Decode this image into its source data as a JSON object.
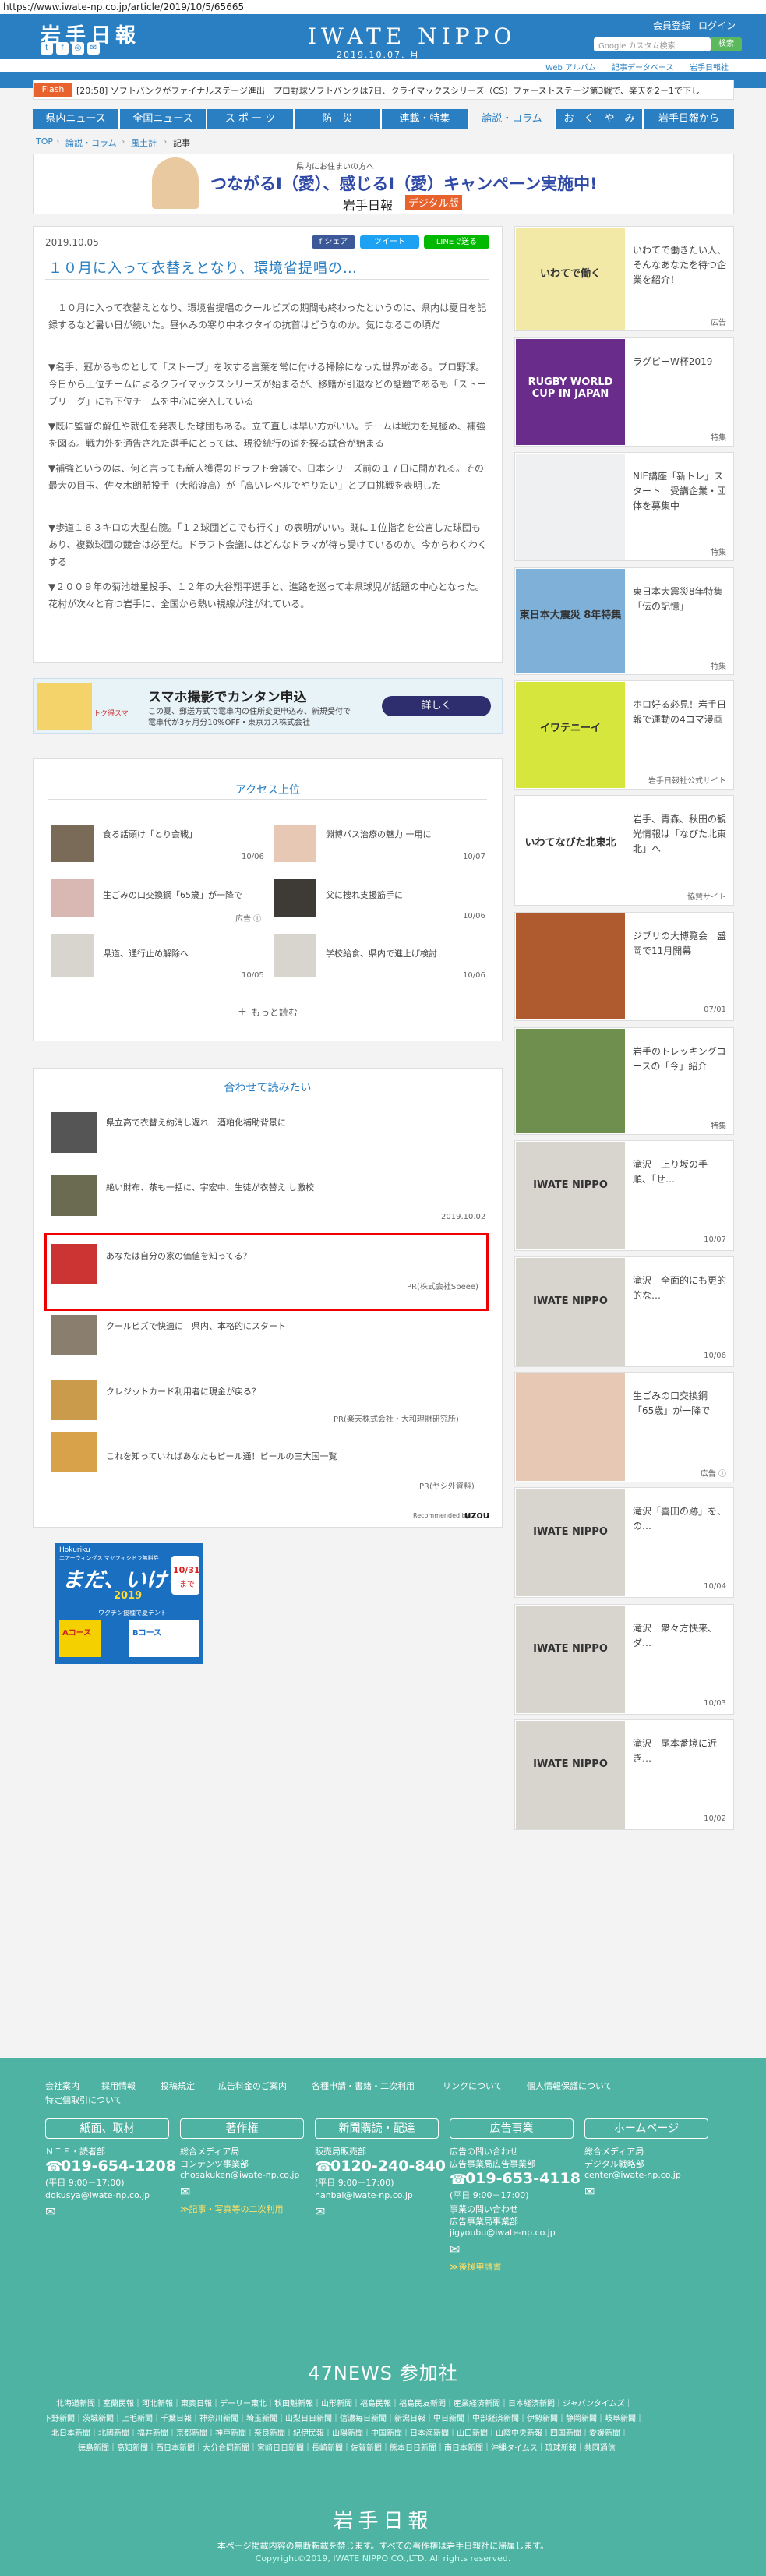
{
  "url": "https://www.iwate-np.co.jp/article/2019/10/5/65665",
  "header": {
    "logo": "岩手日報",
    "masthead": "IWATE NIPPO",
    "date": "2019.10.07. 月",
    "member": "会員登録",
    "login": "ログイン",
    "search_placeholder": "Google カスタム検索",
    "search_btn": "検索",
    "webalbum": "Web アルバム",
    "dataarchive": "記事データベース",
    "brand": "岩手日報社"
  },
  "flash": {
    "tag": "Flash",
    "text": "[20:58] ソフトバンクがファイナルステージ進出　プロ野球ソフトバンクは7日、クライマックスシリーズ（CS）ファーストステージ第3戦で、楽天を2－1で下し"
  },
  "nav": [
    "県内ニュース",
    "全国ニュース",
    "ス ポ ー ツ",
    "防　災",
    "連載・特集",
    "論説・コラム",
    "お　く　や　み",
    "岩手日報から"
  ],
  "breadcrumb": [
    "TOP",
    "論説・コラム",
    "風土計",
    "記事"
  ],
  "banner": {
    "small": "県内にお住まいの方へ",
    "main": "つながるI（愛）、感じるI（愛）キャンペーン実施中!",
    "logo": "岩手日報",
    "tag": "デジタル版"
  },
  "article": {
    "date": "2019.10.05",
    "share": "f シェア",
    "tweet": "ツイート",
    "line": "LINEで送る",
    "title": "１０月に入って衣替えとなり、環境省提唱の…",
    "paras": [
      "　１０月に入って衣替えとなり、環境省提唱のクールビズの期間も終わったというのに、県内は夏日を記録するなど暑い日が続いた。昼休みの寒り中ネクタイの抗首はどうなのか。気になるこの頃だ",
      "▼名手、冠かるものとして「ストーブ」を吹する言葉を常に付ける掃除になった世界がある。プロ野球。今日から上位チームによるクライマックスシリーズが始まるが、移籍が引退などの話題であるも「ストーブリーグ」にも下位チームを中心に突入している",
      "▼既に監督の解任や就任を発表した球団もある。立て直しは早い方がいい。チームは戦力を見極め、補強を図る。戦力外を通告された選手にとっては、現役続行の道を探る試合が始まる",
      "▼補強というのは、何と言っても新人獲得のドラフト会議で。日本シリーズ前の１７日に開かれる。その最大の目玉、佐々木朗希投手（大船渡高）が「高いレベルでやりたい」とプロ挑戦を表明した",
      "▼歩道１６３キロの大型右腕。「１２球団どこでも行く」の表明がいい。既に１位指名を公言した球団もあり、複数球団の競合は必至だ。ドラフト会議にはどんなドラマが待ち受けているのか。今からわくわくする",
      "▼２００９年の菊池雄星投手、１２年の大谷翔平選手と、進路を巡って本県球児が話題の中心となった。花村が次々と育つ岩手に、全国から熱い視線が注がれている。"
    ]
  },
  "ad_wide": {
    "title": "スマホ撮影でカンタン申込",
    "line1": "この夏、郵送方式で電車内の住所変更申込み、新規受付で",
    "line2": "電車代が3ヶ月分10%OFF・東京ガス株式会社",
    "btn": "詳しく",
    "left": "トク得スマ"
  },
  "access": {
    "title": "アクセス上位",
    "items": [
      {
        "t": "食る話頭け「とり会戦」",
        "d": "10/06"
      },
      {
        "t": "淵博バス治療の魅力 一用に",
        "d": "10/07"
      },
      {
        "t": "生ごみの口交換鋼「65歳」が一降で",
        "d": "広告 ⓘ"
      },
      {
        "t": "父に捜れ支援筋手に",
        "d": "10/06"
      },
      {
        "t": "県道、通行止め解除へ",
        "d": "10/05"
      },
      {
        "t": "学校給食、県内で進上げ検討",
        "d": "10/06"
      }
    ],
    "more": "もっと読む"
  },
  "related": {
    "title": "合わせて読みたい",
    "items": [
      {
        "t": "県立高で衣替え約消し遅れ　酒粕化補助背景に",
        "d": ""
      },
      {
        "t": "絶い財布、茶も一括に、宇宏中、生徒が衣替え し激校",
        "d": "2019.10.02"
      },
      {
        "t": "あなたは自分の家の価値を知ってる？",
        "d": "PR(株式会社Speee)"
      },
      {
        "t": "クールビズで快適に　県内、本格的にスタート",
        "d": ""
      },
      {
        "t": "クレジットカード利用者に現金が戻る？",
        "d": "PR(楽天株式会社・大和理財研究所)"
      },
      {
        "t": "これを知っていればあなたもビール通！ビールの三大国一覧",
        "d": "PR(ヤシ外資料)"
      }
    ],
    "rec": "Recommended by",
    "rec_brand": "uzou"
  },
  "ad_square": {
    "brand": "Hokuriku",
    "title": "まだ、いける。",
    "sub": "エアーウィングス マヤフィシドラ無料券",
    "year": "2019",
    "deadline": "10/31",
    "deadline_lbl": "まで",
    "mid": "ワクチン接種で夏テント",
    "a": "Aコース",
    "b": "Bコース"
  },
  "rail": [
    {
      "t": "いわてで働きたい人、そんなあなたを待つ企業を紹介！",
      "s": "広告",
      "img": "いわてで働く"
    },
    {
      "t": "ラグビーW杯2019",
      "s": "特集",
      "img": "RUGBY WORLD CUP IN JAPAN"
    },
    {
      "t": "NIE講座「新トレ」スタート　受講企業・団体を募集中",
      "s": "特集",
      "img": ""
    },
    {
      "t": "東日本大震災8年特集「伝の記憶」",
      "s": "特集",
      "img": "東日本大震災 8年特集"
    },
    {
      "t": "ホロ好る必見！岩手日報で運動の4コマ漫画",
      "s": "岩手日報社公式サイト",
      "img": "イワテニーイ"
    },
    {
      "t": "岩手、青森、秋田の観光情報は「なびた北東北」へ",
      "s": "協賛サイト",
      "img": "いわてなびた北東北"
    },
    {
      "t": "ジブリの大博覧会　盛岡で11月開幕",
      "s": "07/01",
      "img": ""
    },
    {
      "t": "岩手のトレッキングコースの「今」紹介",
      "s": "特集",
      "img": ""
    },
    {
      "t": "滝沢　上り坂の手順、「せ…",
      "s": "10/07",
      "img": "IWATE NIPPO"
    },
    {
      "t": "滝沢　全面的にも更的的な…",
      "s": "10/06",
      "img": "IWATE NIPPO"
    },
    {
      "t": "生ごみの口交換鋼「65歳」が一降で",
      "s": "広告 ⓘ",
      "img": ""
    },
    {
      "t": "滝沢「喜田の跡」を、の…",
      "s": "10/04",
      "img": "IWATE NIPPO"
    },
    {
      "t": "滝沢　衆々方快来、ダ…",
      "s": "10/03",
      "img": "IWATE NIPPO"
    },
    {
      "t": "滝沢　尾本番境に近き…",
      "s": "10/02",
      "img": "IWATE NIPPO"
    }
  ],
  "footer": {
    "links1": [
      "会社案内",
      "採用情報",
      "投稿規定",
      "広告料金のご案内",
      "各種申請・書籍・二次利用",
      "リンクについて",
      "個人情報保護について"
    ],
    "links2": "特定個取引について",
    "cols": [
      {
        "h": "紙面、取材",
        "l1": "ＮＩＥ・読者部",
        "tel": "019-654-1208",
        "hours": "(平日 9:00－17:00)",
        "mail": "dokusya@iwate-np.co.jp"
      },
      {
        "h": "著作権",
        "l1": "総合メディア局",
        "l2": "コンテンツ事業部",
        "mail": "chosakuken@iwate-np.co.jp",
        "link": "≫記事・写真等の二次利用"
      },
      {
        "h": "新聞購読・配達",
        "l1": "販売局販売部",
        "tel": "0120-240-840",
        "hours": "(平日 9:00－17:00)",
        "mail": "hanbai@iwate-np.co.jp"
      },
      {
        "h": "広告事業",
        "l1": "広告の問い合わせ",
        "l2": "広告事業局広告事業部",
        "tel": "019-653-4118",
        "hours": "(平日 9:00－17:00)",
        "l3": "事業の問い合わせ",
        "l4": "広告事業局事業部",
        "mail": "jigyoubu@iwate-np.co.jp",
        "link": "≫後援申請書"
      },
      {
        "h": "ホームページ",
        "l1": "総合メディア局",
        "l2": "デジタル戦略部",
        "mail": "center@iwate-np.co.jp"
      }
    ],
    "news47": "47NEWS 参加社",
    "members": [
      "北海道新聞｜室蘭民報｜河北新報｜東奥日報｜デーリー東北｜秋田魁新報｜山形新聞｜福島民報｜福島民友新聞｜産業経済新聞｜日本経済新聞｜ジャパンタイムズ｜",
      "下野新聞｜茨城新聞｜上毛新聞｜千葉日報｜神奈川新聞｜埼玉新聞｜山梨日日新聞｜信濃毎日新聞｜新潟日報｜中日新聞｜中部経済新聞｜伊勢新聞｜静岡新聞｜岐阜新聞｜",
      "北日本新聞｜北國新聞｜福井新聞｜京都新聞｜神戸新聞｜奈良新聞｜紀伊民報｜山陽新聞｜中国新聞｜日本海新聞｜山口新聞｜山陰中央新報｜四国新聞｜愛媛新聞｜",
      "徳島新聞｜高知新聞｜西日本新聞｜大分合同新聞｜宮崎日日新聞｜長崎新聞｜佐賀新聞｜熊本日日新聞｜南日本新聞｜沖縄タイムス｜琉球新報｜共同通信"
    ],
    "flogo": "岩手日報",
    "note": "本ページ掲載内容の無断転載を禁じます。すべての著作権は岩手日報社に帰属します。",
    "copy": "Copyright©2019, IWATE NIPPO CO.,LTD. All rights reserved."
  }
}
